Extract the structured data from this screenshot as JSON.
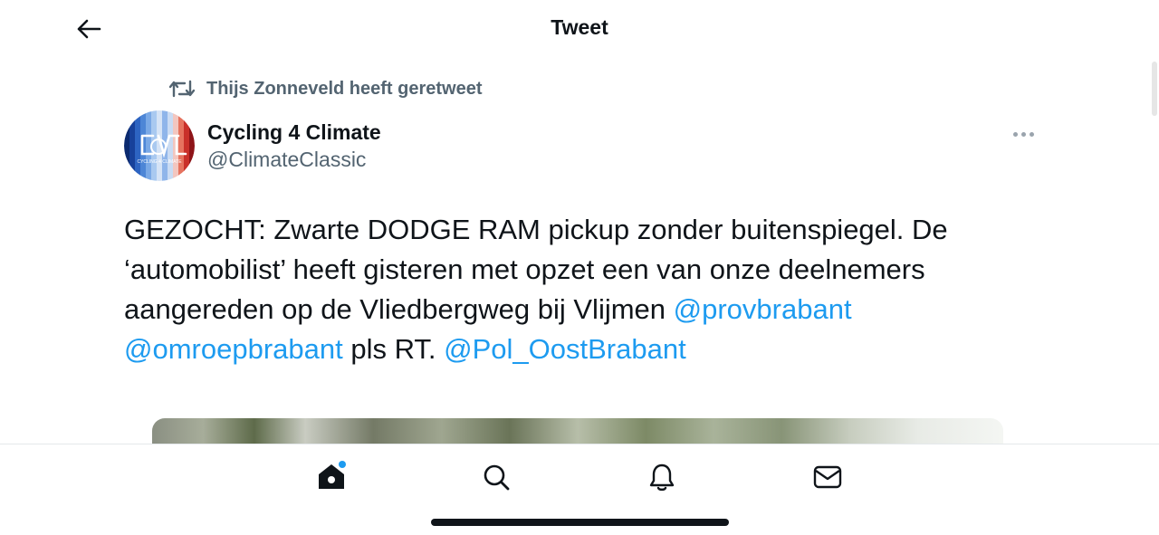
{
  "header": {
    "title": "Tweet"
  },
  "retweet": {
    "label": "Thijs Zonneveld heeft geretweet"
  },
  "author": {
    "name": "Cycling 4 Climate",
    "handle": "@ClimateClassic",
    "avatar_text": "CYCLING 4 CLIMATE"
  },
  "tweet": {
    "text_1": "GEZOCHT: Zwarte DODGE RAM pickup zonder buitenspiegel. De ‘automobilist’ heeft gisteren met opzet een van onze deelnemers aangereden op de Vliedbergweg bij Vlijmen ",
    "mention_1": "@provbrabant",
    "mention_2": "@omroepbrabant",
    "text_2": " pls RT. ",
    "mention_3": "@Pol_OostBrabant"
  },
  "tabs": [
    {
      "name": "home-icon"
    },
    {
      "name": "search-icon"
    },
    {
      "name": "bell-icon"
    },
    {
      "name": "mail-icon"
    }
  ],
  "colors": {
    "accent": "#1d9bf0",
    "text": "#0f1419",
    "muted": "#536471"
  }
}
